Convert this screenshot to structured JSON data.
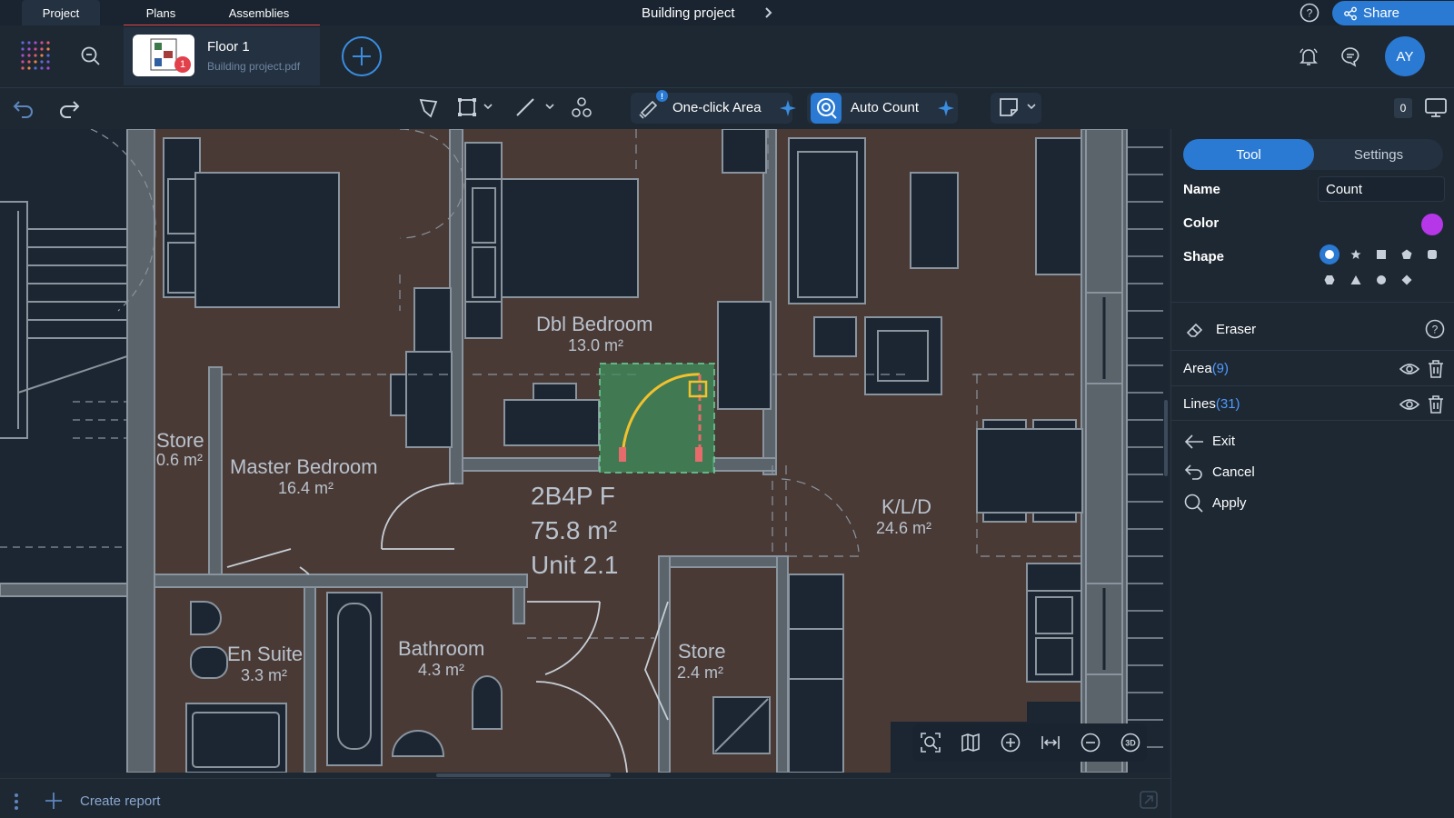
{
  "topbar": {
    "tabs": [
      {
        "label": "Project"
      },
      {
        "label": "Plans"
      },
      {
        "label": "Assemblies"
      }
    ],
    "project_title": "Building project",
    "share_label": "Share"
  },
  "header": {
    "file": {
      "name": "Floor 1",
      "filename": "Building project.pdf",
      "badge": "1"
    },
    "avatar": "AY"
  },
  "toolbar": {
    "one_click_area": "One-click Area",
    "one_click_badge": "!",
    "auto_count": "Auto Count",
    "counter": "0"
  },
  "plan": {
    "rooms": [
      {
        "name": "Dbl Bedroom",
        "area": "13.0 m²"
      },
      {
        "name": "Store",
        "area": "0.6 m²"
      },
      {
        "name": "Master Bedroom",
        "area": "16.4 m²"
      },
      {
        "name": "K/L/D",
        "area": "24.6 m²"
      },
      {
        "name": "En Suite",
        "area": "3.3 m²"
      },
      {
        "name": "Bathroom",
        "area": "4.3 m²"
      },
      {
        "name": "Store",
        "area": "2.4 m²"
      }
    ],
    "unit": {
      "type": "2B4P F",
      "area": "75.8 m²",
      "name": "Unit 2.1"
    },
    "selection_color": "#3f8f5e",
    "door_color": "#f2c12e"
  },
  "bottombar": {
    "create_report": "Create report"
  },
  "panel": {
    "tabs": {
      "tool": "Tool",
      "settings": "Settings"
    },
    "name_label": "Name",
    "name_value": "Count",
    "color_label": "Color",
    "color_value": "#b637e8",
    "shape_label": "Shape",
    "shapes": [
      "circle",
      "star",
      "square",
      "pentagon",
      "rounded-square",
      "hexagon",
      "triangle",
      "circle",
      "diamond"
    ],
    "selected_shape": "circle",
    "eraser_label": "Eraser",
    "area_label": "Area",
    "area_count": "(9)",
    "lines_label": "Lines",
    "lines_count": "(31)",
    "exit_label": "Exit",
    "cancel_label": "Cancel",
    "apply_label": "Apply"
  }
}
